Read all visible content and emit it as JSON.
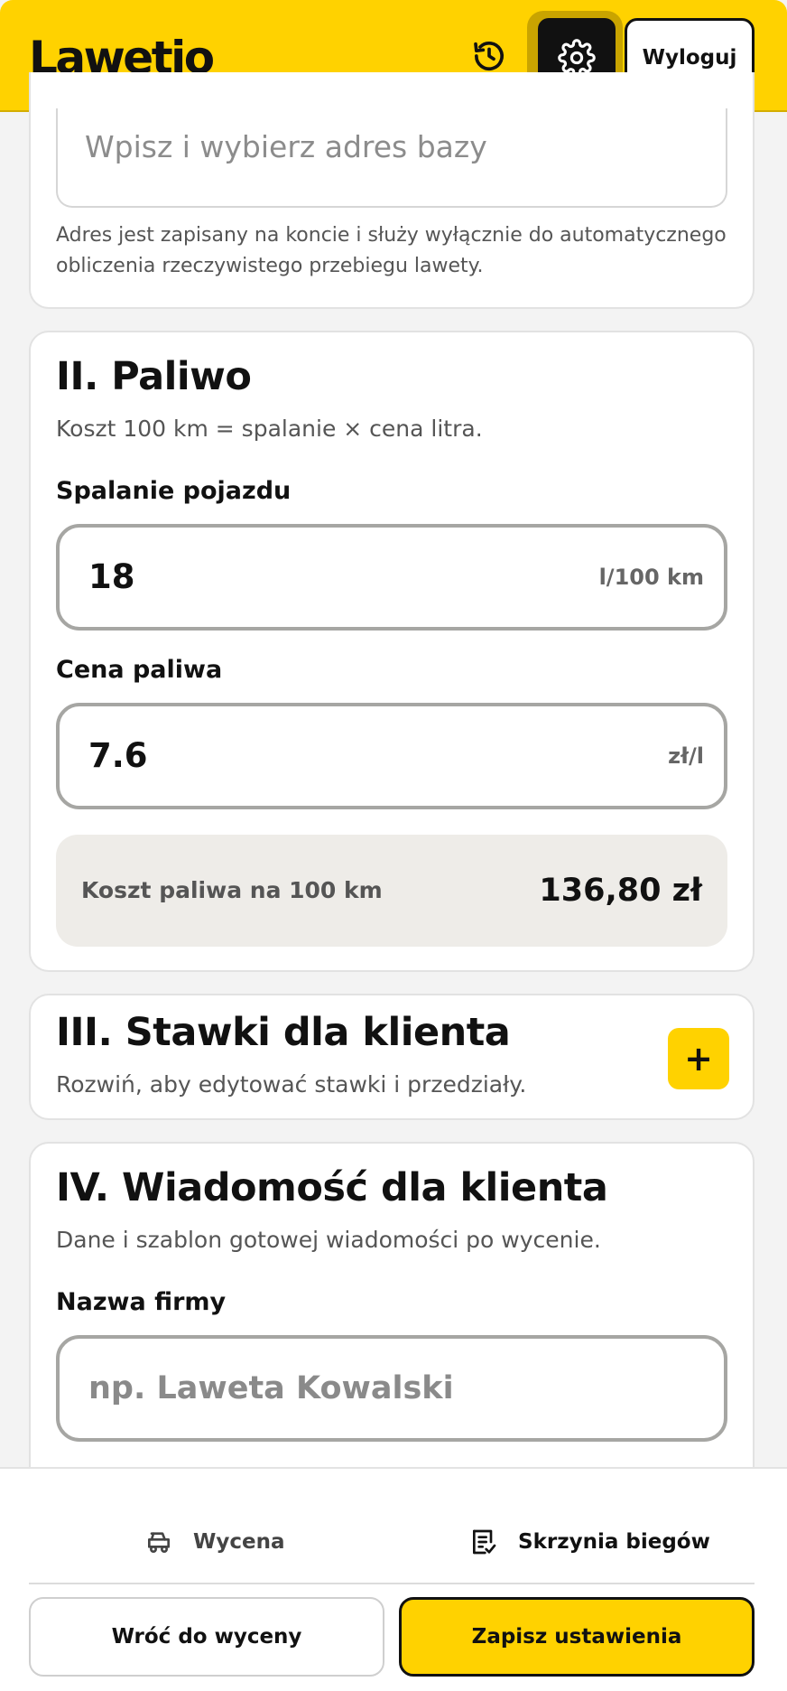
{
  "header": {
    "logo": "Lawetio",
    "history_icon": "history-icon",
    "settings_icon": "gear-icon",
    "logout_label": "Wyloguj",
    "accent_color": "#ffd200"
  },
  "section_base": {
    "address_placeholder": "Wpisz i wybierz adres bazy",
    "note": "Adres jest zapisany na koncie i służy wyłącznie do automatycznego obliczenia rzeczywistego przebiegu lawety.",
    "note_line1": "Adres jest zapisany na koncie i służy wyłącznie do automatycznego",
    "note_line2": "obliczenia rzeczywistego przebiegu lawety."
  },
  "section_fuel": {
    "title": "II. Paliwo",
    "subtitle": "Koszt 100 km = spalanie × cena litra.",
    "consumption_label": "Spalanie pojazdu",
    "consumption_value": "18",
    "consumption_unit": "l/100 km",
    "price_label": "Cena paliwa",
    "price_value": "7.6",
    "price_unit": "zł/l",
    "cost_label": "Koszt paliwa na 100 km",
    "cost_value": "136,80 zł"
  },
  "section_rates": {
    "title": "III. Stawki dla klienta",
    "subtitle": "Rozwiń, aby edytować stawki i przedziały.",
    "expand_label": "+"
  },
  "section_message": {
    "title": "IV. Wiadomość dla klienta",
    "subtitle": "Dane i szablon gotowej wiadomości po wycenie.",
    "company_label": "Nazwa firmy",
    "company_placeholder": "np. Laweta Kowalski"
  },
  "bottom_nav": {
    "items": [
      {
        "label": "Wycena",
        "icon": "tow-truck-icon"
      },
      {
        "label": "Skrzynia biegów",
        "icon": "gearbox-list-icon"
      }
    ],
    "back_label": "Wróć do wyceny",
    "save_label": "Zapisz ustawienia"
  }
}
